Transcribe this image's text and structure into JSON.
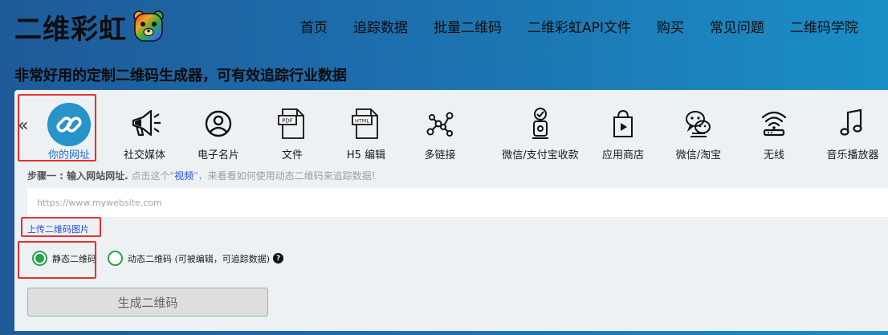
{
  "logo": {
    "text": "二维彩虹",
    "icon": "rainbow-bear-icon"
  },
  "nav": [
    {
      "label": "首页"
    },
    {
      "label": "追踪数据"
    },
    {
      "label": "批量二维码"
    },
    {
      "label": "二维彩虹API文件"
    },
    {
      "label": "购买"
    },
    {
      "label": "常见问题"
    },
    {
      "label": "二维码学院"
    }
  ],
  "tagline": "非常好用的定制二维码生成器，可有效追踪行业数据",
  "types": [
    {
      "label": "你的网址",
      "icon": "link-icon",
      "active": true
    },
    {
      "label": "社交媒体",
      "icon": "megaphone-icon"
    },
    {
      "label": "电子名片",
      "icon": "user-circle-icon"
    },
    {
      "label": "文件",
      "icon": "pdf-file-icon"
    },
    {
      "label": "H5 编辑",
      "icon": "html-file-icon"
    },
    {
      "label": "多链接",
      "icon": "network-icon"
    },
    {
      "label": "微信/支付宝收款",
      "icon": "payment-icon"
    },
    {
      "label": "应用商店",
      "icon": "app-store-icon"
    },
    {
      "label": "微信/淘宝",
      "icon": "wechat-icon"
    },
    {
      "label": "无线",
      "icon": "wifi-icon"
    },
    {
      "label": "音乐播放器",
      "icon": "music-icon"
    }
  ],
  "step": {
    "prefix": "步骤一 : 输入网站网址.",
    "middle": " 点击这个\"",
    "link": "视频",
    "suffix": "\"，来看看如何使用动态二维码来追踪数据!"
  },
  "url_input": {
    "placeholder": "https://www.mywebsite.com",
    "value": ""
  },
  "upload_label": "上传二维码图片",
  "radio_static": {
    "label": "静态二维码",
    "checked": true
  },
  "radio_dynamic": {
    "label": "动态二维码 (可被编辑，可追踪数据)",
    "checked": false
  },
  "generate_label": "生成二维码",
  "colors": {
    "accent": "#2693c9",
    "green": "#2aa24a",
    "highlight": "#e53030"
  }
}
